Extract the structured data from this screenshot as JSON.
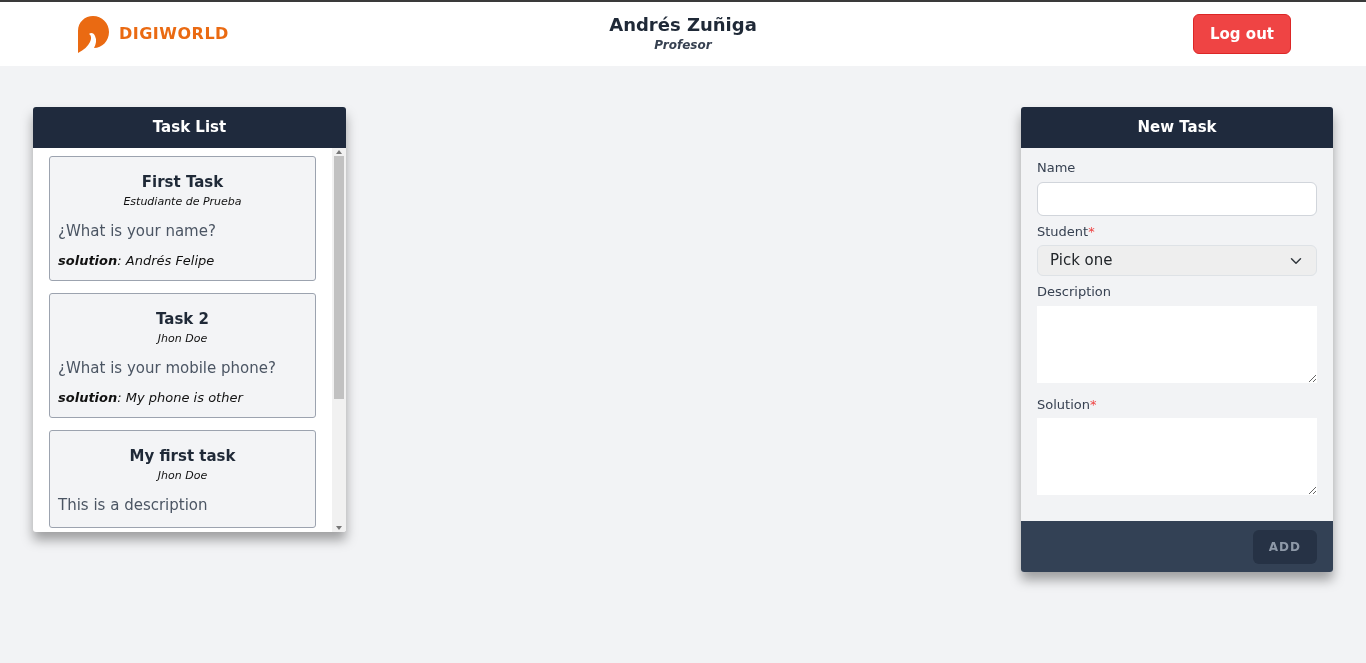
{
  "header": {
    "brand": "DIGIWORLD",
    "user_name": "Andrés Zuñiga",
    "user_role": "Profesor",
    "logout": "Log out"
  },
  "task_list": {
    "title": "Task List",
    "tasks": [
      {
        "title": "First Task",
        "student": "Estudiante de Prueba",
        "description": "¿What is your name?",
        "solution": "**solution**: Andrés Felipe"
      },
      {
        "title": "Task 2",
        "student": "Jhon Doe",
        "description": "¿What is your mobile phone?",
        "solution": "**solution**: My phone is other"
      },
      {
        "title": "My first task",
        "student": "Jhon Doe",
        "description": "This is a description"
      }
    ]
  },
  "new_task": {
    "title": "New Task",
    "fields": [
      {
        "kind": "input",
        "label": "Name"
      },
      {
        "kind": "select",
        "label": "Student",
        "required_mark": "*",
        "value": "Pick one"
      },
      {
        "kind": "textarea",
        "label": "Description"
      },
      {
        "kind": "textarea",
        "label": "Solution",
        "required_mark": "*"
      }
    ],
    "submit": {
      "label": "ADD",
      "disabled": true
    }
  }
}
